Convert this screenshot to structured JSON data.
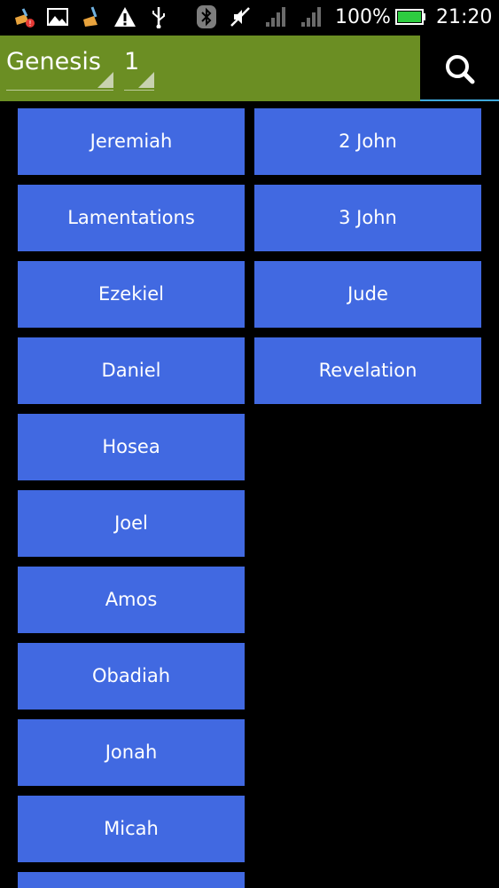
{
  "status_bar": {
    "icons_left": [
      "cleaner-app-icon",
      "gallery-icon",
      "cleaner-broom-icon",
      "warning-icon",
      "usb-icon"
    ],
    "icons_right": [
      "bluetooth-icon",
      "muted-icon",
      "signal-icon",
      "signal-icon-2",
      "battery-icon"
    ],
    "battery_percent": "100%",
    "time": "21:20",
    "battery_color": "#2ecc40"
  },
  "toolbar": {
    "book_selector": "Genesis",
    "chapter_selector": "1",
    "search_icon": "search-icon",
    "background_color": "#6b8e23",
    "accent_color": "#3fa9dc"
  },
  "books": {
    "column_left": [
      "Jeremiah",
      "Lamentations",
      "Ezekiel",
      "Daniel",
      "Hosea",
      "Joel",
      "Amos",
      "Obadiah",
      "Jonah",
      "Micah",
      ""
    ],
    "column_right": [
      "2 John",
      "3 John",
      "Jude",
      "Revelation"
    ],
    "button_color": "#4169e1"
  }
}
